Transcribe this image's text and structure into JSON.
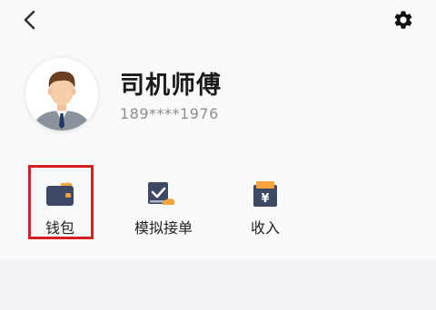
{
  "header": {
    "back_icon": "chevron-left-icon",
    "settings_icon": "gear-icon"
  },
  "profile": {
    "name": "司机师傅",
    "phone": "189****1976",
    "avatar_icon": "driver-avatar"
  },
  "menu": {
    "items": [
      {
        "label": "钱包",
        "icon": "wallet-icon"
      },
      {
        "label": "模拟接单",
        "icon": "mock-order-icon"
      },
      {
        "label": "收入",
        "icon": "income-icon"
      }
    ]
  },
  "colors": {
    "icon_navy": "#3d4864",
    "icon_orange": "#f5a33b",
    "highlight": "#d21f1f"
  }
}
